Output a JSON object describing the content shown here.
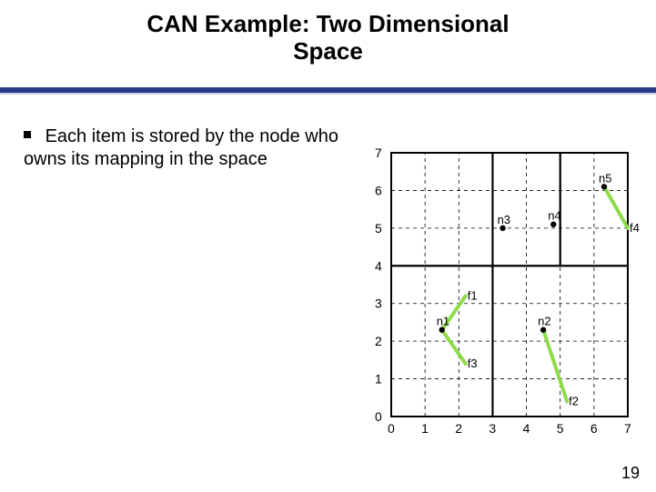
{
  "title_line1": "CAN Example: Two Dimensional",
  "title_line2": "Space",
  "bullet": "Each item is stored by the node who owns its mapping in the space",
  "page_number": "19",
  "chart_data": {
    "type": "scatter",
    "xlabel": "",
    "ylabel": "",
    "xlim": [
      0,
      7
    ],
    "ylim": [
      0,
      7
    ],
    "x_ticks": [
      0,
      1,
      2,
      3,
      4,
      5,
      6,
      7
    ],
    "y_ticks": [
      0,
      1,
      2,
      3,
      4,
      5,
      6,
      7
    ],
    "zones": [
      {
        "x": 0,
        "y": 0,
        "w": 3,
        "h": 4,
        "owner": "n1"
      },
      {
        "x": 3,
        "y": 0,
        "w": 4,
        "h": 4,
        "owner": "n2"
      },
      {
        "x": 0,
        "y": 4,
        "w": 3,
        "h": 3,
        "owner": "n3"
      },
      {
        "x": 3,
        "y": 4,
        "w": 2,
        "h": 3,
        "owner": "n4"
      },
      {
        "x": 5,
        "y": 4,
        "w": 2,
        "h": 3,
        "owner": "n5"
      }
    ],
    "nodes": [
      {
        "name": "n1",
        "x": 1.5,
        "y": 2.3
      },
      {
        "name": "n2",
        "x": 4.5,
        "y": 2.3
      },
      {
        "name": "n3",
        "x": 3.3,
        "y": 5.0
      },
      {
        "name": "n4",
        "x": 4.8,
        "y": 5.1
      },
      {
        "name": "n5",
        "x": 6.3,
        "y": 6.1
      }
    ],
    "items": [
      {
        "name": "f1",
        "x": 2.2,
        "y": 3.2
      },
      {
        "name": "f2",
        "x": 5.2,
        "y": 0.4
      },
      {
        "name": "f3",
        "x": 2.2,
        "y": 1.4
      },
      {
        "name": "f4",
        "x": 7.0,
        "y": 5.0
      }
    ]
  }
}
